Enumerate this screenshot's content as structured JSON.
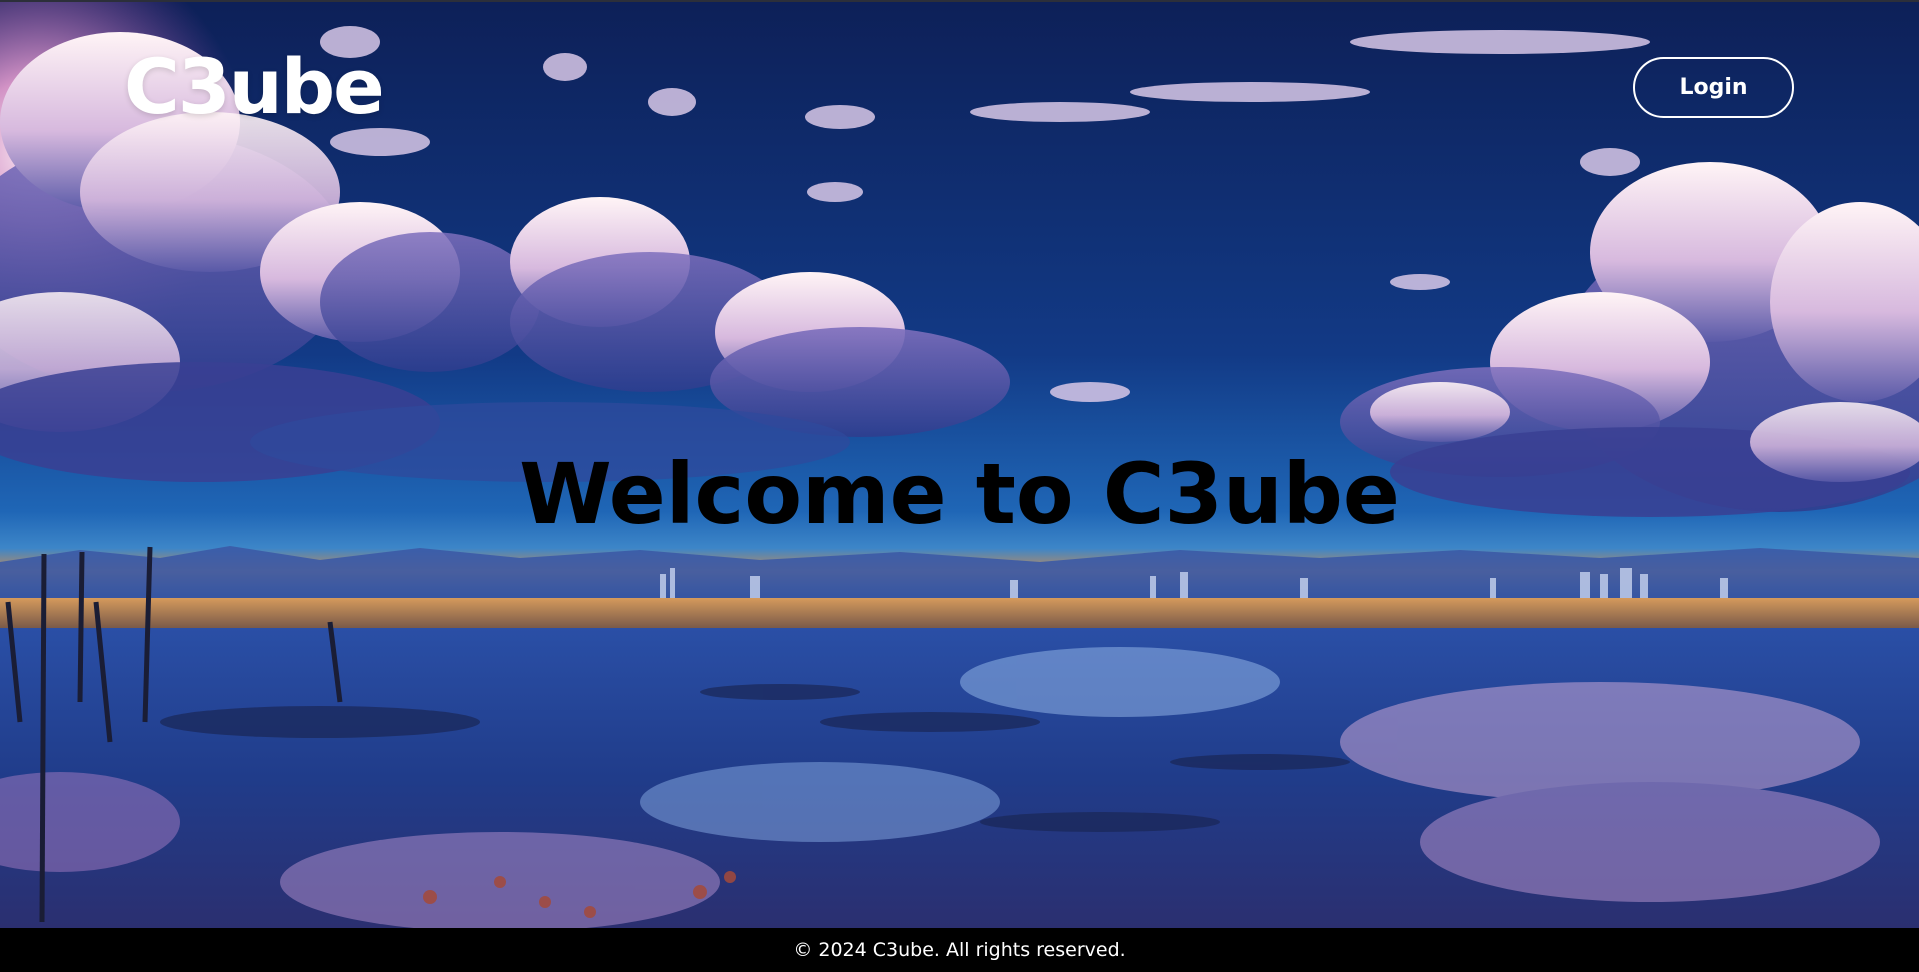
{
  "header": {
    "logo_text": "C3ube",
    "login_label": "Login"
  },
  "hero": {
    "headline": "Welcome to C3ube",
    "background": "anime-style sky with clouds reflected over water, city skyline on horizon"
  },
  "footer": {
    "copyright": "© 2024 C3ube. All rights reserved."
  },
  "colors": {
    "footer_background": "#000000",
    "logo_text": "#ffffff",
    "headline_text": "#000000",
    "login_border": "#ffffff"
  }
}
